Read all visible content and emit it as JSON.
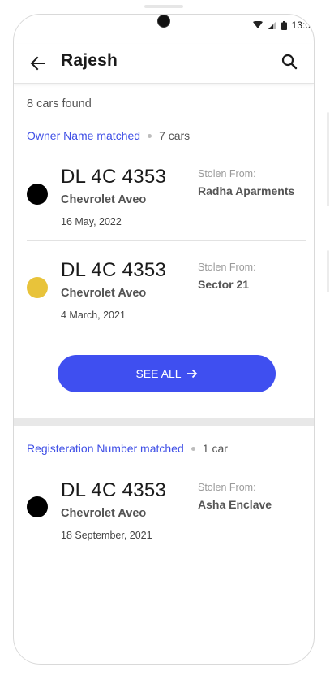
{
  "status_bar": {
    "time": "13:0"
  },
  "header": {
    "title": "Rajesh"
  },
  "results": {
    "count_text": "8 cars found"
  },
  "sections": [
    {
      "title": "Owner Name matched",
      "count": "7 cars",
      "cars": [
        {
          "plate": "DL 4C 4353",
          "model": "Chevrolet Aveo",
          "date": "16 May, 2022",
          "stolen_label": "Stolen From:",
          "stolen_from": "Radha Aparments",
          "dot_color": "#000000"
        },
        {
          "plate": "DL 4C 4353",
          "model": "Chevrolet Aveo",
          "date": "4 March, 2021",
          "stolen_label": "Stolen From:",
          "stolen_from": "Sector 21",
          "dot_color": "#e8c33a"
        }
      ],
      "see_all_label": "SEE ALL"
    },
    {
      "title": "Registeration Number matched",
      "count": "1 car",
      "cars": [
        {
          "plate": "DL 4C 4353",
          "model": "Chevrolet Aveo",
          "date": "18 September, 2021",
          "stolen_label": "Stolen From:",
          "stolen_from": "Asha Enclave",
          "dot_color": "#000000"
        }
      ]
    }
  ],
  "colors": {
    "accent": "#3f4ff0",
    "link_blue": "#3f4fe6"
  },
  "icons": {
    "back": "arrow-left-icon",
    "search": "search-icon",
    "see_all_arrow": "arrow-right-icon"
  }
}
